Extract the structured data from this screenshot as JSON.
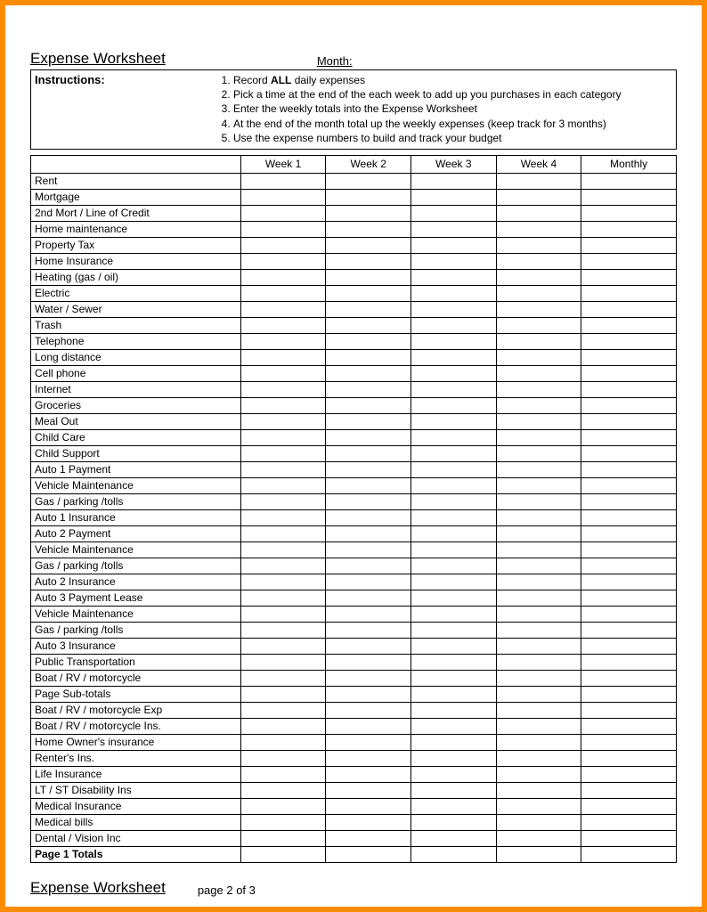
{
  "header": {
    "title": "Expense Worksheet",
    "month_label": "Month:",
    "instructions_label": "Instructions:",
    "bold_word": "ALL",
    "instructions": [
      "Record ALL daily expenses",
      "Pick a time at the end of the each week to add up you purchases in each category",
      "Enter the weekly totals into the Expense Worksheet",
      "At the end of the month total up the weekly expenses (keep track for 3 months)",
      "Use the expense numbers to build and track your budget"
    ]
  },
  "columns": [
    "",
    "Week 1",
    "Week 2",
    "Week 3",
    "Week 4",
    "Monthly"
  ],
  "rows": [
    "Rent",
    "Mortgage",
    "2nd Mort / Line of Credit",
    "Home maintenance",
    "Property Tax",
    "Home Insurance",
    "Heating (gas / oil)",
    "Electric",
    "Water / Sewer",
    "Trash",
    "Telephone",
    "Long distance",
    "Cell phone",
    "Internet",
    "Groceries",
    "Meal Out",
    "Child Care",
    "Child Support",
    "Auto 1 Payment",
    "Vehicle Maintenance",
    "Gas / parking /tolls",
    "Auto 1 Insurance",
    "Auto 2 Payment",
    "Vehicle Maintenance",
    "Gas / parking /tolls",
    "Auto 2 Insurance",
    "Auto 3 Payment Lease",
    "Vehicle Maintenance",
    "Gas / parking /tolls",
    "Auto 3 Insurance",
    "Public Transportation",
    "Boat / RV / motorcycle",
    "Page Sub-totals",
    "Boat / RV / motorcycle Exp",
    "Boat / RV / motorcycle Ins.",
    "Home Owner's insurance",
    "Renter's Ins.",
    "Life Insurance",
    "LT / ST Disability Ins",
    "Medical Insurance",
    "Medical bills",
    "Dental / Vision Inc"
  ],
  "totals_label": "Page 1 Totals",
  "footer": {
    "title": "Expense Worksheet",
    "page": "page 2 of 3"
  }
}
